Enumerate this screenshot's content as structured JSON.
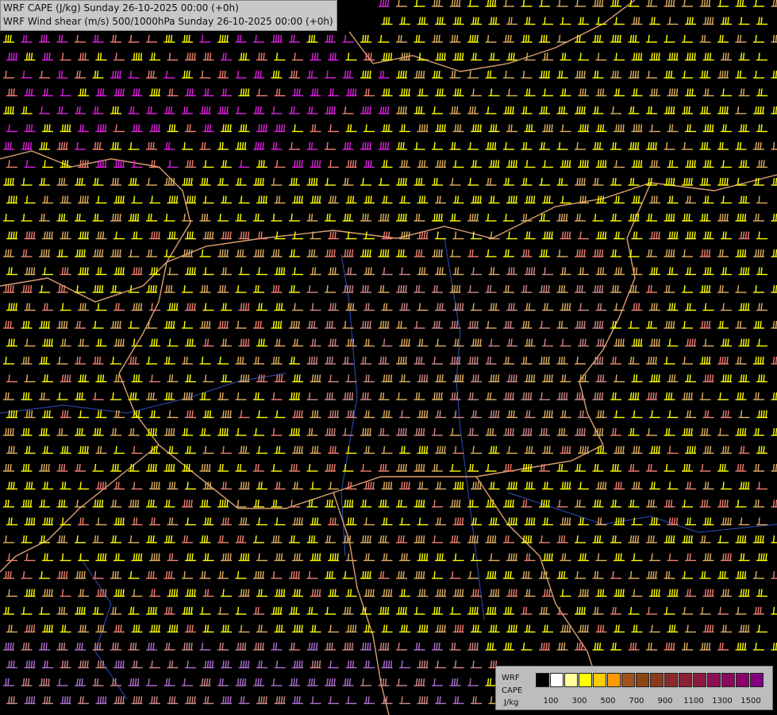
{
  "titles": {
    "line1": "WRF CAPE (J/kg) Sunday 26-10-2025 00:00 (+0h)",
    "line2": "WRF Wind shear (m/s) 500/1000hPa Sunday 26-10-2025 00:00 (+0h)"
  },
  "legend": {
    "label_line1": "WRF",
    "label_line2": "CAPE",
    "label_line3": "J/kg",
    "ticks": [
      "100",
      "300",
      "500",
      "700",
      "900",
      "1100",
      "1300",
      "1500"
    ],
    "colors": [
      "#000000",
      "#ffffff",
      "#ffff99",
      "#ffff00",
      "#ffcc00",
      "#ff9900",
      "#a0521c",
      "#8b4513",
      "#8b3a1a",
      "#8b2a2a",
      "#8b2035",
      "#8b1a40",
      "#8b1050",
      "#8b0a60",
      "#8b006b",
      "#800080"
    ]
  },
  "map_colors": {
    "barb_yellow": "#ffff00",
    "barb_tan": "#e0b060",
    "barb_salmon": "#f08070",
    "barb_rose": "#d08a88",
    "barb_magenta": "#e020e0",
    "barb_violet": "#b070d0",
    "border": "#d9a070",
    "river": "#3050c0"
  }
}
